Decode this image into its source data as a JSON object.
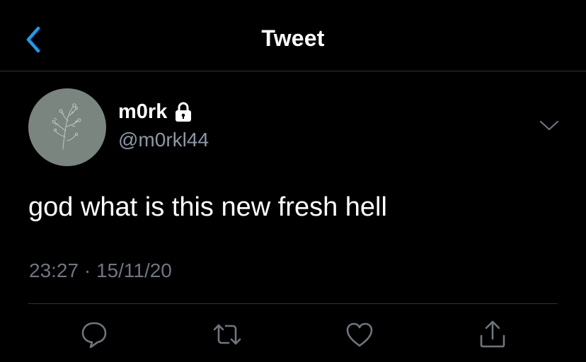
{
  "nav": {
    "title": "Tweet",
    "back_icon": "chevron-left-icon",
    "accent_color": "#1d9bf0"
  },
  "tweet": {
    "author": {
      "display_name": "m0rk",
      "handle": "@m0rkl44",
      "protected_icon": "lock-icon"
    },
    "text": "god what is this new fresh hell",
    "time": "23:27",
    "separator": "·",
    "date": "15/11/20"
  },
  "actions": [
    {
      "name": "reply",
      "icon": "speech-bubble-icon"
    },
    {
      "name": "retweet",
      "icon": "retweet-arrows-icon"
    },
    {
      "name": "like",
      "icon": "heart-icon"
    },
    {
      "name": "share",
      "icon": "share-upload-icon"
    }
  ],
  "colors": {
    "background": "#000000",
    "text_primary": "#ffffff",
    "text_secondary": "#8b98a5",
    "icon_gray": "#6e767d",
    "divider": "#2f3336",
    "avatar_bg": "#7b8580"
  }
}
